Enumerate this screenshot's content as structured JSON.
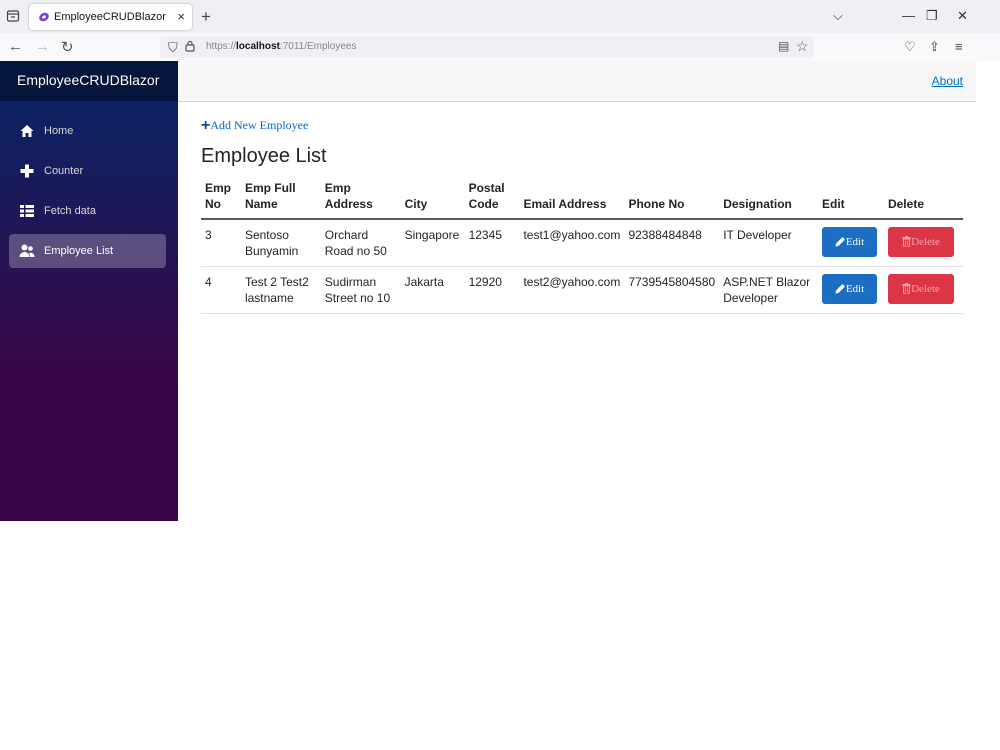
{
  "browser": {
    "tab_title": "EmployeeCRUDBlazor",
    "url_prefix": "https://",
    "url_host": "localhost",
    "url_rest": ":7011/Employees"
  },
  "sidebar": {
    "brand": "EmployeeCRUDBlazor",
    "items": [
      {
        "label": "Home",
        "icon": "home-icon"
      },
      {
        "label": "Counter",
        "icon": "plus-icon"
      },
      {
        "label": "Fetch data",
        "icon": "list-icon"
      },
      {
        "label": "Employee List",
        "icon": "people-icon",
        "active": true
      }
    ]
  },
  "top": {
    "about": "About"
  },
  "main": {
    "add_link": "Add New Employee",
    "title": "Employee List",
    "columns": [
      "Emp No",
      "Emp Full Name",
      "Emp Address",
      "City",
      "Postal Code",
      "Email Address",
      "Phone No",
      "Designation",
      "Edit",
      "Delete"
    ],
    "rows": [
      {
        "no": "3",
        "name": "Sentoso Bunyamin",
        "address": "Orchard Road no 50",
        "city": "Singapore",
        "postal": "12345",
        "email": "test1@yahoo.com",
        "phone": "92388484848",
        "designation": "IT Developer"
      },
      {
        "no": "4",
        "name": "Test 2 Test2 lastname",
        "address": "Sudirman Street no 10",
        "city": "Jakarta",
        "postal": "12920",
        "email": "test2@yahoo.com",
        "phone": "7739545804580",
        "designation": "ASP.NET Blazor Developer"
      }
    ],
    "edit_label": "Edit",
    "delete_label": "Delete"
  },
  "colors": {
    "sidebar_top": "#052767",
    "sidebar_bottom": "#3a0647",
    "edit_button": "#1b6ec2",
    "delete_button": "#dc3545",
    "link": "#0071c1"
  }
}
